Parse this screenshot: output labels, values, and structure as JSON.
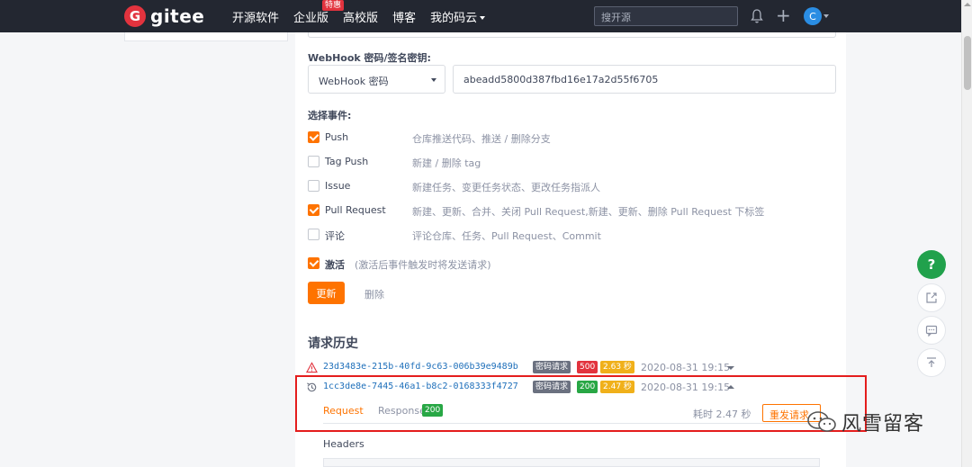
{
  "nav": {
    "logo_letter": "G",
    "logo_text": "gitee",
    "links": [
      "开源软件",
      "企业版",
      "高校版",
      "博客",
      "我的码云"
    ],
    "enterprise_badge": "特惠",
    "search_placeholder": "搜开源",
    "avatar_letter": "C"
  },
  "form": {
    "secret_label": "WebHook 密码/签名密钥:",
    "secret_type": "WebHook 密码",
    "secret_value": "abeadd5800d387fbd16e17a2d55f6705",
    "events_label": "选择事件:",
    "events": [
      {
        "name": "Push",
        "desc": "仓库推送代码、推送 / 删除分支",
        "checked": true
      },
      {
        "name": "Tag Push",
        "desc": "新建 / 删除 tag",
        "checked": false
      },
      {
        "name": "Issue",
        "desc": "新建任务、变更任务状态、更改任务指派人",
        "checked": false
      },
      {
        "name": "Pull Request",
        "desc": "新建、更新、合并、关闭 Pull Request,新建、更新、删除 Pull Request 下标签",
        "checked": true
      },
      {
        "name": "评论",
        "desc": "评论仓库、任务、Pull Request、Commit",
        "checked": false
      }
    ],
    "activate_label": "激活",
    "activate_hint": "(激活后事件触发时将发送请求)",
    "activate_checked": true,
    "update_button": "更新",
    "delete_button": "删除"
  },
  "history": {
    "title": "请求历史",
    "rows": [
      {
        "id": "23d3483e-215b-40fd-9c63-006b39e9489b",
        "type_tag": "密码请求",
        "status": "500",
        "duration": "2.63 秒",
        "time": "2020-08-31 19:15",
        "state": "error"
      },
      {
        "id": "1cc3de8e-7445-46a1-b8c2-0168333f4727",
        "type_tag": "密码请求",
        "status": "200",
        "duration": "2.47 秒",
        "time": "2020-08-31 19:15",
        "state": "ok"
      }
    ],
    "detail": {
      "tab_request": "Request",
      "tab_response": "Response",
      "response_status": "200",
      "elapsed": "耗时 2.47 秒",
      "resend_button": "重发请求",
      "headers_label": "Headers"
    }
  },
  "side_tools": {
    "help": "?"
  },
  "watermark": "风雪留客",
  "colors": {
    "accent": "#fe7300",
    "nav_bg": "#232731",
    "brand": "#e2333e",
    "success": "#28a745",
    "warning": "#f0b01a",
    "highlight": "#e41d1d"
  }
}
